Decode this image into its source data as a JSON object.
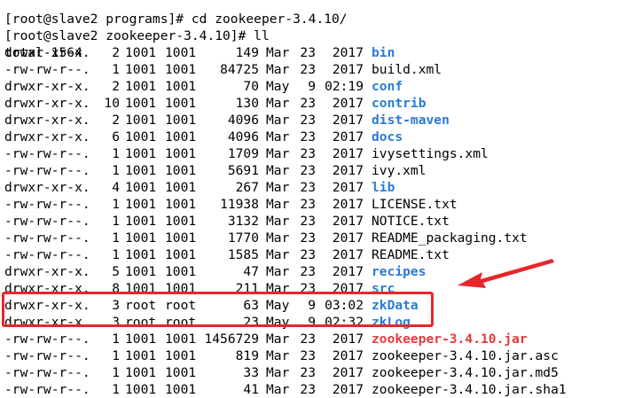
{
  "terminal": {
    "top_partial": "[root@slave2 programs]# cd zookeeper-3.4.10/",
    "prompt": "[root@slave2 zookeeper-3.4.10]# ll",
    "total": "total 1564",
    "entries": [
      {
        "perms": "drwxr-xr-x.",
        "links": "2",
        "owner": "1001",
        "group": "1001",
        "size": "149",
        "month": "Mar",
        "day": "23",
        "time": "2017",
        "name": "bin",
        "type": "dir"
      },
      {
        "perms": "-rw-rw-r--.",
        "links": "1",
        "owner": "1001",
        "group": "1001",
        "size": "84725",
        "month": "Mar",
        "day": "23",
        "time": "2017",
        "name": "build.xml",
        "type": "file"
      },
      {
        "perms": "drwxr-xr-x.",
        "links": "2",
        "owner": "1001",
        "group": "1001",
        "size": "70",
        "month": "May",
        "day": "9",
        "time": "02:19",
        "name": "conf",
        "type": "dir"
      },
      {
        "perms": "drwxr-xr-x.",
        "links": "10",
        "owner": "1001",
        "group": "1001",
        "size": "130",
        "month": "Mar",
        "day": "23",
        "time": "2017",
        "name": "contrib",
        "type": "dir"
      },
      {
        "perms": "drwxr-xr-x.",
        "links": "2",
        "owner": "1001",
        "group": "1001",
        "size": "4096",
        "month": "Mar",
        "day": "23",
        "time": "2017",
        "name": "dist-maven",
        "type": "dir"
      },
      {
        "perms": "drwxr-xr-x.",
        "links": "6",
        "owner": "1001",
        "group": "1001",
        "size": "4096",
        "month": "Mar",
        "day": "23",
        "time": "2017",
        "name": "docs",
        "type": "dir"
      },
      {
        "perms": "-rw-rw-r--.",
        "links": "1",
        "owner": "1001",
        "group": "1001",
        "size": "1709",
        "month": "Mar",
        "day": "23",
        "time": "2017",
        "name": "ivysettings.xml",
        "type": "file"
      },
      {
        "perms": "-rw-rw-r--.",
        "links": "1",
        "owner": "1001",
        "group": "1001",
        "size": "5691",
        "month": "Mar",
        "day": "23",
        "time": "2017",
        "name": "ivy.xml",
        "type": "file"
      },
      {
        "perms": "drwxr-xr-x.",
        "links": "4",
        "owner": "1001",
        "group": "1001",
        "size": "267",
        "month": "Mar",
        "day": "23",
        "time": "2017",
        "name": "lib",
        "type": "dir"
      },
      {
        "perms": "-rw-rw-r--.",
        "links": "1",
        "owner": "1001",
        "group": "1001",
        "size": "11938",
        "month": "Mar",
        "day": "23",
        "time": "2017",
        "name": "LICENSE.txt",
        "type": "file"
      },
      {
        "perms": "-rw-rw-r--.",
        "links": "1",
        "owner": "1001",
        "group": "1001",
        "size": "3132",
        "month": "Mar",
        "day": "23",
        "time": "2017",
        "name": "NOTICE.txt",
        "type": "file"
      },
      {
        "perms": "-rw-rw-r--.",
        "links": "1",
        "owner": "1001",
        "group": "1001",
        "size": "1770",
        "month": "Mar",
        "day": "23",
        "time": "2017",
        "name": "README_packaging.txt",
        "type": "file"
      },
      {
        "perms": "-rw-rw-r--.",
        "links": "1",
        "owner": "1001",
        "group": "1001",
        "size": "1585",
        "month": "Mar",
        "day": "23",
        "time": "2017",
        "name": "README.txt",
        "type": "file"
      },
      {
        "perms": "drwxr-xr-x.",
        "links": "5",
        "owner": "1001",
        "group": "1001",
        "size": "47",
        "month": "Mar",
        "day": "23",
        "time": "2017",
        "name": "recipes",
        "type": "dir"
      },
      {
        "perms": "drwxr-xr-x.",
        "links": "8",
        "owner": "1001",
        "group": "1001",
        "size": "211",
        "month": "Mar",
        "day": "23",
        "time": "2017",
        "name": "src",
        "type": "dir"
      },
      {
        "perms": "drwxr-xr-x.",
        "links": "3",
        "owner": "root",
        "group": "root",
        "size": "63",
        "month": "May",
        "day": "9",
        "time": "03:02",
        "name": "zkData",
        "type": "dir"
      },
      {
        "perms": "drwxr-xr-x.",
        "links": "3",
        "owner": "root",
        "group": "root",
        "size": "23",
        "month": "May",
        "day": "9",
        "time": "02:32",
        "name": "zkLog",
        "type": "dir"
      },
      {
        "perms": "-rw-rw-r--.",
        "links": "1",
        "owner": "1001",
        "group": "1001",
        "size": "1456729",
        "month": "Mar",
        "day": "23",
        "time": "2017",
        "name": "zookeeper-3.4.10.jar",
        "type": "exe"
      },
      {
        "perms": "-rw-rw-r--.",
        "links": "1",
        "owner": "1001",
        "group": "1001",
        "size": "819",
        "month": "Mar",
        "day": "23",
        "time": "2017",
        "name": "zookeeper-3.4.10.jar.asc",
        "type": "file"
      },
      {
        "perms": "-rw-rw-r--.",
        "links": "1",
        "owner": "1001",
        "group": "1001",
        "size": "33",
        "month": "Mar",
        "day": "23",
        "time": "2017",
        "name": "zookeeper-3.4.10.jar.md5",
        "type": "file"
      },
      {
        "perms": "-rw-rw-r--.",
        "links": "1",
        "owner": "1001",
        "group": "1001",
        "size": "41",
        "month": "Mar",
        "day": "23",
        "time": "2017",
        "name": "zookeeper-3.4.10.jar.sha1",
        "type": "file"
      }
    ]
  },
  "colors": {
    "directory": "#2a7bd6",
    "executable": "#e53a3a",
    "annotation": "#e8262a"
  },
  "icons": {
    "annotation_arrow": "arrow-icon"
  }
}
